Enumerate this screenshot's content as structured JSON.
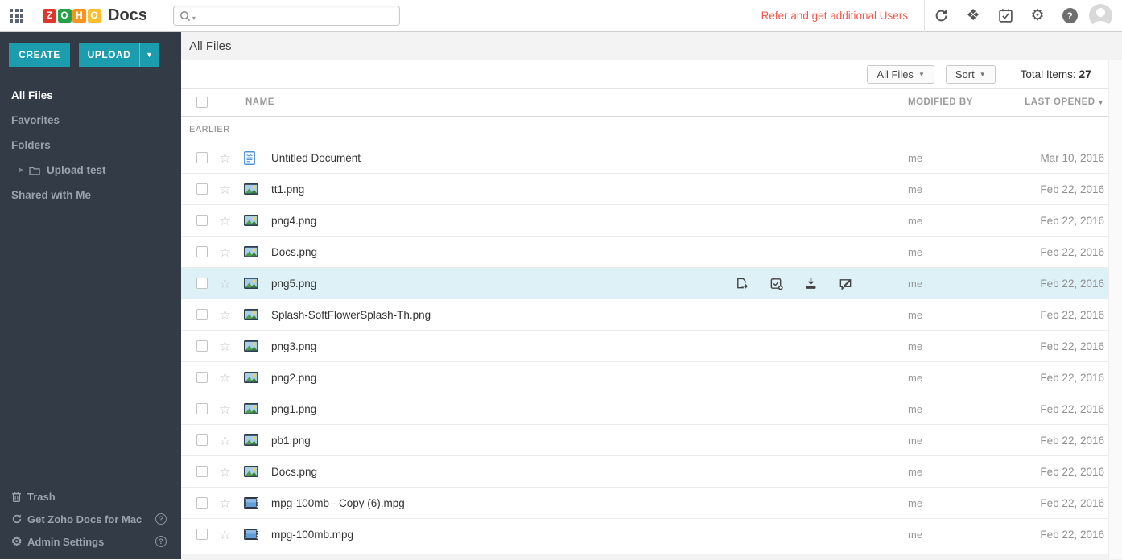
{
  "topbar": {
    "product_name": "Docs",
    "logo_tiles": [
      {
        "letter": "Z",
        "color": "#e0352b"
      },
      {
        "letter": "O",
        "color": "#28a049"
      },
      {
        "letter": "H",
        "color": "#f7941d"
      },
      {
        "letter": "O",
        "color": "#fdbf2d"
      }
    ],
    "search": {
      "placeholder": ""
    },
    "refer_link": "Refer and get additional Users",
    "icons": [
      "sync-icon",
      "dropbox-icon",
      "tasks-icon",
      "settings-icon",
      "help-icon",
      "avatar"
    ]
  },
  "sidebar": {
    "create_label": "CREATE",
    "upload_label": "UPLOAD",
    "items": [
      {
        "label": "All Files",
        "active": true
      },
      {
        "label": "Favorites"
      },
      {
        "label": "Folders"
      },
      {
        "label": "Upload test",
        "type": "folder"
      },
      {
        "label": "Shared with Me"
      }
    ],
    "footer_items": [
      {
        "label": "Trash",
        "icon": "trash-icon"
      },
      {
        "label": "Get Zoho Docs for Mac",
        "icon": "sync-icon",
        "help": true
      },
      {
        "label": "Admin Settings",
        "icon": "gear-icon",
        "help": true
      }
    ]
  },
  "main": {
    "title": "All Files",
    "filter_button_label": "All Files",
    "sort_button_label": "Sort",
    "total_items_label": "Total Items:",
    "total_items_value": "27",
    "table": {
      "headers": {
        "name": "NAME",
        "modified_by": "MODIFIED BY",
        "last_opened": "LAST OPENED"
      },
      "section_label": "EARLIER",
      "row_action_icons": [
        "share-file-icon",
        "add-task-icon",
        "download-icon",
        "edit-comment-icon"
      ],
      "rows": [
        {
          "name": "Untitled Document",
          "type": "doc",
          "modified_by": "me",
          "last_opened": "Mar 10, 2016"
        },
        {
          "name": "tt1.png",
          "type": "image",
          "modified_by": "me",
          "last_opened": "Feb 22, 2016"
        },
        {
          "name": "png4.png",
          "type": "image",
          "modified_by": "me",
          "last_opened": "Feb 22, 2016"
        },
        {
          "name": "Docs.png",
          "type": "image",
          "modified_by": "me",
          "last_opened": "Feb 22, 2016"
        },
        {
          "name": "png5.png",
          "type": "image",
          "modified_by": "me",
          "last_opened": "Feb 22, 2016",
          "highlighted": true
        },
        {
          "name": "Splash-SoftFlowerSplash-Th.png",
          "type": "image",
          "modified_by": "me",
          "last_opened": "Feb 22, 2016"
        },
        {
          "name": "png3.png",
          "type": "image",
          "modified_by": "me",
          "last_opened": "Feb 22, 2016"
        },
        {
          "name": "png2.png",
          "type": "image",
          "modified_by": "me",
          "last_opened": "Feb 22, 2016"
        },
        {
          "name": "png1.png",
          "type": "image",
          "modified_by": "me",
          "last_opened": "Feb 22, 2016"
        },
        {
          "name": "pb1.png",
          "type": "image",
          "modified_by": "me",
          "last_opened": "Feb 22, 2016"
        },
        {
          "name": "Docs.png",
          "type": "image",
          "modified_by": "me",
          "last_opened": "Feb 22, 2016"
        },
        {
          "name": "mpg-100mb - Copy (6).mpg",
          "type": "video",
          "modified_by": "me",
          "last_opened": "Feb 22, 2016"
        },
        {
          "name": "mpg-100mb.mpg",
          "type": "video",
          "modified_by": "me",
          "last_opened": "Feb 22, 2016"
        }
      ]
    }
  },
  "colors": {
    "accent_teal": "#1b9daf",
    "sidebar_bg": "#323b46",
    "highlight_row": "#def1f6",
    "refer_link": "#f2594b"
  }
}
